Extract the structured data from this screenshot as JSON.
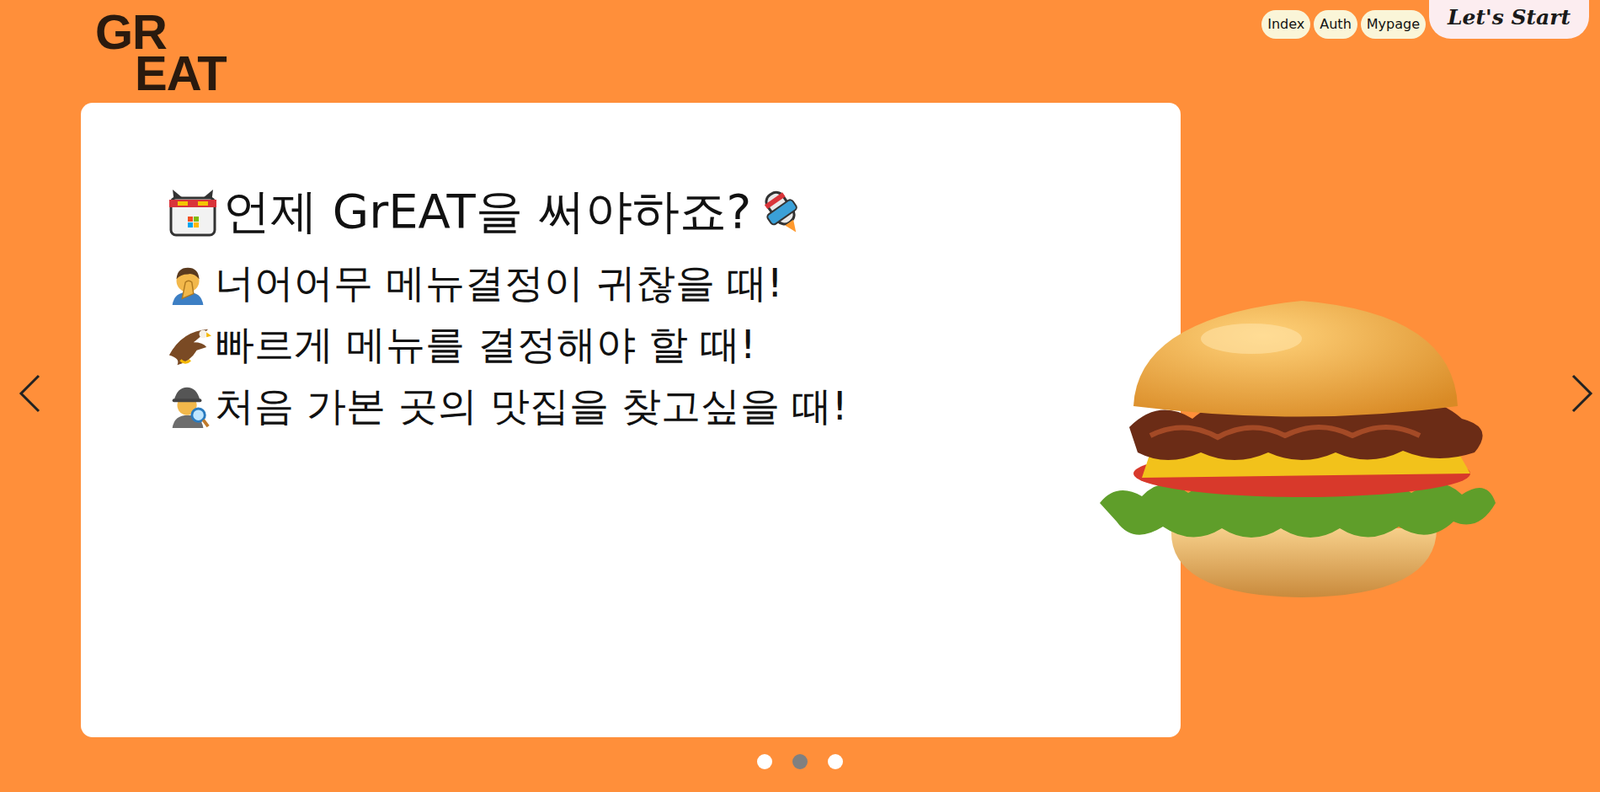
{
  "logo": {
    "lines": [
      "GR",
      "EAT"
    ]
  },
  "nav": {
    "items": [
      {
        "label": "Index"
      },
      {
        "label": "Auth"
      },
      {
        "label": "Mypage"
      }
    ],
    "cta": "Let's Start"
  },
  "carousel": {
    "title": "언제 GrEAT을 써야하죠?",
    "items": [
      "너어어무 메뉴결정이 귀찮을 때!",
      "빠르게 메뉴를 결정해야 할 때!",
      "처음 가본 곳의 맛집을 찾고싶을 때!"
    ],
    "indicators": [
      {
        "selected": false
      },
      {
        "selected": true
      },
      {
        "selected": false
      }
    ]
  }
}
